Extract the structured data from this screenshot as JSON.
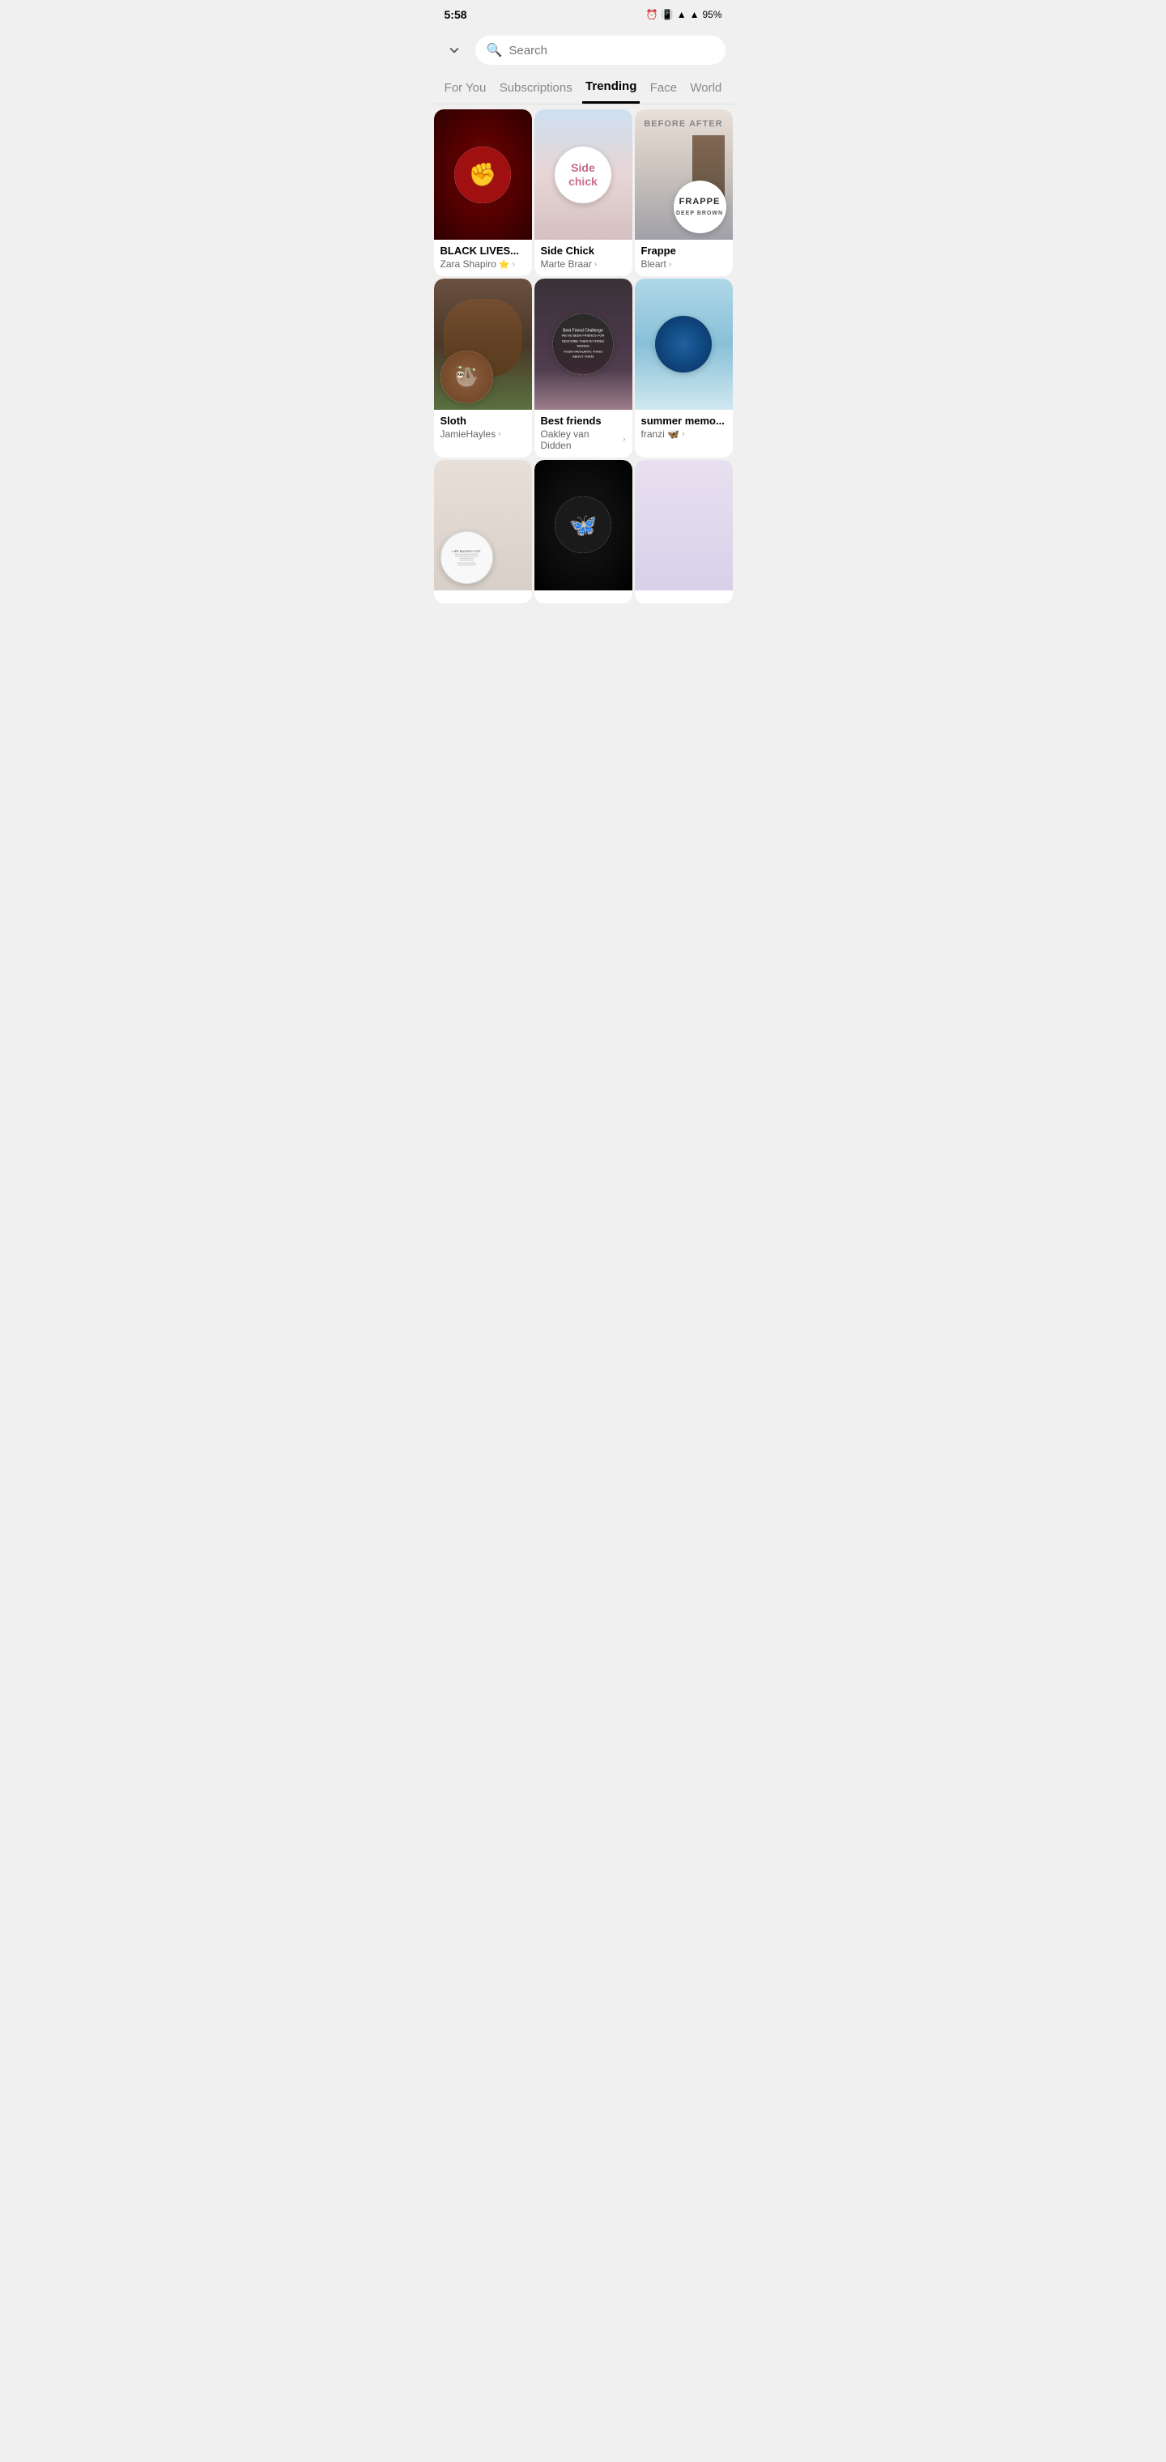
{
  "status_bar": {
    "time": "5:58",
    "battery": "95%"
  },
  "search": {
    "placeholder": "Search"
  },
  "nav": {
    "tabs": [
      {
        "id": "for-you",
        "label": "For You",
        "active": false
      },
      {
        "id": "subscriptions",
        "label": "Subscriptions",
        "active": false
      },
      {
        "id": "trending",
        "label": "Trending",
        "active": true
      },
      {
        "id": "face",
        "label": "Face",
        "active": false
      },
      {
        "id": "world",
        "label": "World",
        "active": false
      }
    ]
  },
  "cards": [
    {
      "id": "black-lives",
      "title": "BLACK LIVES...",
      "author": "Zara Shapiro",
      "verified": true,
      "bg": "1"
    },
    {
      "id": "side-chick",
      "title": "Side Chick",
      "author": "Marte Braar",
      "verified": false,
      "bg": "2"
    },
    {
      "id": "frappe",
      "title": "Frappe",
      "author": "Bleart",
      "verified": false,
      "bg": "3"
    },
    {
      "id": "sloth",
      "title": "Sloth",
      "author": "JamieHayles",
      "verified": false,
      "bg": "4"
    },
    {
      "id": "best-friends",
      "title": "Best friends",
      "author": "Oakley van Didden",
      "verified": false,
      "bg": "5"
    },
    {
      "id": "summer-memo",
      "title": "summer memo...",
      "author": "franzi 🦋",
      "verified": false,
      "bg": "6"
    },
    {
      "id": "card-7",
      "title": "",
      "author": "",
      "verified": false,
      "bg": "7"
    },
    {
      "id": "card-8",
      "title": "",
      "author": "",
      "verified": false,
      "bg": "8"
    },
    {
      "id": "card-9",
      "title": "",
      "author": "",
      "verified": false,
      "bg": "9"
    }
  ]
}
